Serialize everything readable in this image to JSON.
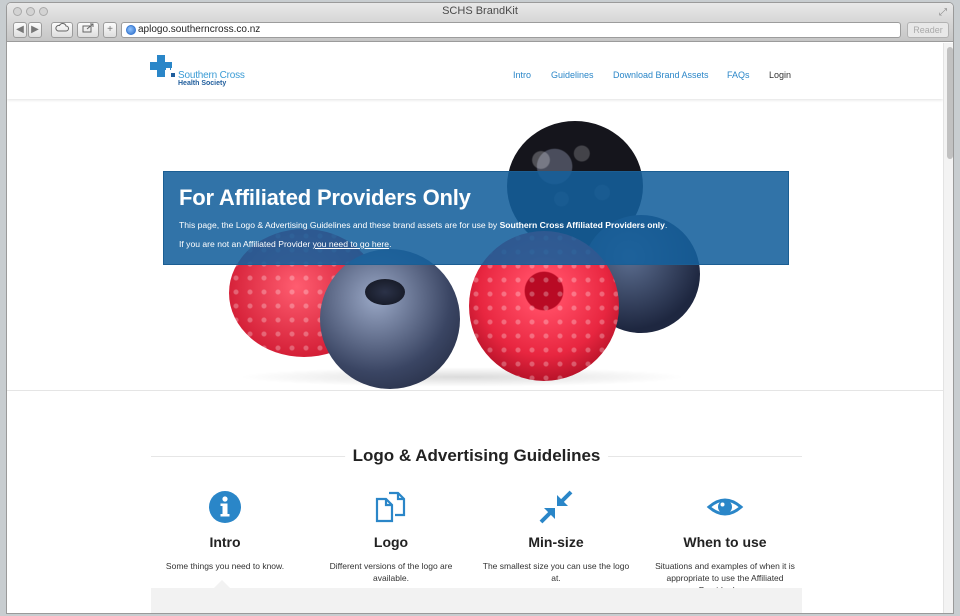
{
  "window": {
    "title": "SCHS BrandKit"
  },
  "toolbar": {
    "url": "aplogo.southerncross.co.nz",
    "reader_label": "Reader"
  },
  "header": {
    "logo_line1": "Southern Cross",
    "logo_line2": "Health Society",
    "nav": [
      {
        "label": "Intro"
      },
      {
        "label": "Guidelines"
      },
      {
        "label": "Download Brand Assets"
      },
      {
        "label": "FAQs"
      },
      {
        "label": "Login"
      }
    ]
  },
  "banner": {
    "title": "For Affiliated Providers Only",
    "line1_before": "This page, the Logo & Advertising Guidelines and these brand assets are for use by ",
    "line1_bold": "Southern Cross Affiliated Providers only",
    "line1_after": ".",
    "line2_before": "If you are not an Affiliated Provider ",
    "line2_link": "you need to go here",
    "line2_after": "."
  },
  "guidelines": {
    "title": "Logo & Advertising Guidelines",
    "cards": [
      {
        "icon": "info-icon",
        "title": "Intro",
        "desc": "Some things you need to know."
      },
      {
        "icon": "copy-files-icon",
        "title": "Logo",
        "desc": "Different versions of the logo are available."
      },
      {
        "icon": "shrink-arrows-icon",
        "title": "Min-size",
        "desc": "The smallest size you can use the logo at."
      },
      {
        "icon": "eye-icon",
        "title": "When to use",
        "desc": "Situations and examples of when it is appropriate to use the Affiliated Provider logo."
      }
    ]
  },
  "colors": {
    "brand_blue": "#2a86c8",
    "banner_blue": "#14609c",
    "text_dark": "#222222"
  }
}
